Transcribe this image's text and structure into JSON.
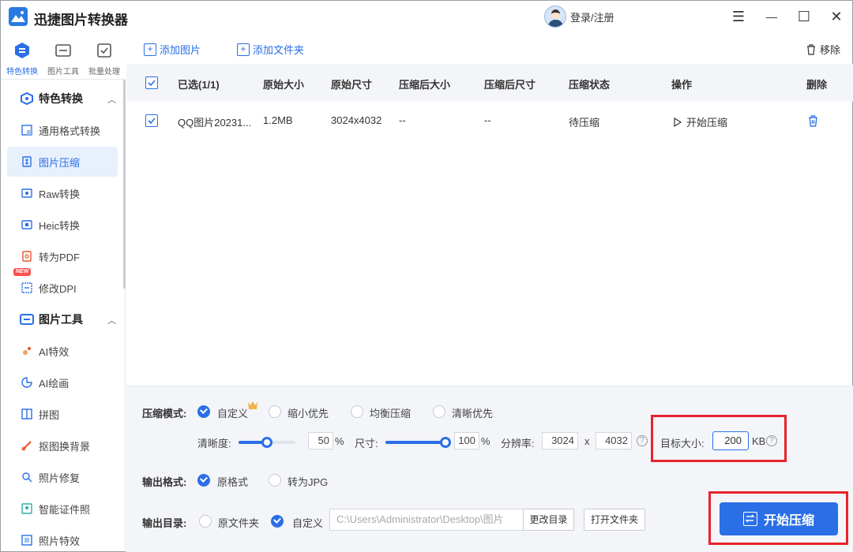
{
  "app": {
    "title": "迅捷图片转换器",
    "login": "登录/注册"
  },
  "window_controls": {
    "menu": "☰",
    "minimize": "—",
    "maximize": "☐",
    "close": "✕"
  },
  "sidetabs": [
    {
      "label": "特色转换",
      "icon": "hexagon-icon"
    },
    {
      "label": "图片工具",
      "icon": "image-tool-icon"
    },
    {
      "label": "批量处理",
      "icon": "batch-icon"
    }
  ],
  "sidebar": {
    "section1": "特色转换",
    "items1": [
      "通用格式转换",
      "图片压缩",
      "Raw转换",
      "Heic转换",
      "转为PDF",
      "修改DPI"
    ],
    "new_badge": "NEW",
    "section2": "图片工具",
    "items2": [
      "AI特效",
      "AI绘画",
      "拼图",
      "抠图换背景",
      "照片修复",
      "智能证件照",
      "照片特效"
    ]
  },
  "toolbar": {
    "add_image": "添加图片",
    "add_folder": "添加文件夹",
    "remove": "移除"
  },
  "table": {
    "headers": [
      "已选(1/1)",
      "原始大小",
      "原始尺寸",
      "压缩后大小",
      "压缩后尺寸",
      "压缩状态",
      "操作",
      "删除"
    ],
    "row": {
      "name": "QQ图片20231...",
      "size": "1.2MB",
      "dimensions": "3024x4032",
      "compressed_size": "--",
      "compressed_dim": "--",
      "status": "待压缩",
      "action": "开始压缩"
    }
  },
  "panel": {
    "mode_label": "压缩模式:",
    "modes": [
      "自定义",
      "缩小优先",
      "均衡压缩",
      "清晰优先"
    ],
    "clarity_label": "清晰度:",
    "clarity_value": "50",
    "clarity_fraction": 0.5,
    "size_label": "尺寸:",
    "size_value": "100",
    "size_fraction": 1.0,
    "percent": "%",
    "resolution_label": "分辨率:",
    "res_w": "3024",
    "res_x": "x",
    "res_h": "4032",
    "target_label": "目标大小:",
    "target_value": "200",
    "target_unit": "KB",
    "output_format_label": "输出格式:",
    "formats": [
      "原格式",
      "转为JPG"
    ],
    "output_dir_label": "输出目录:",
    "dirs": [
      "原文件夹",
      "自定义"
    ],
    "path": "C:\\Users\\Administrator\\Desktop\\图片",
    "change_dir": "更改目录",
    "open_folder": "打开文件夹",
    "start": "开始压缩"
  },
  "colors": {
    "accent": "#2a6fe6",
    "highlight": "#e8232b",
    "panel_bg": "#f3f5f9"
  }
}
